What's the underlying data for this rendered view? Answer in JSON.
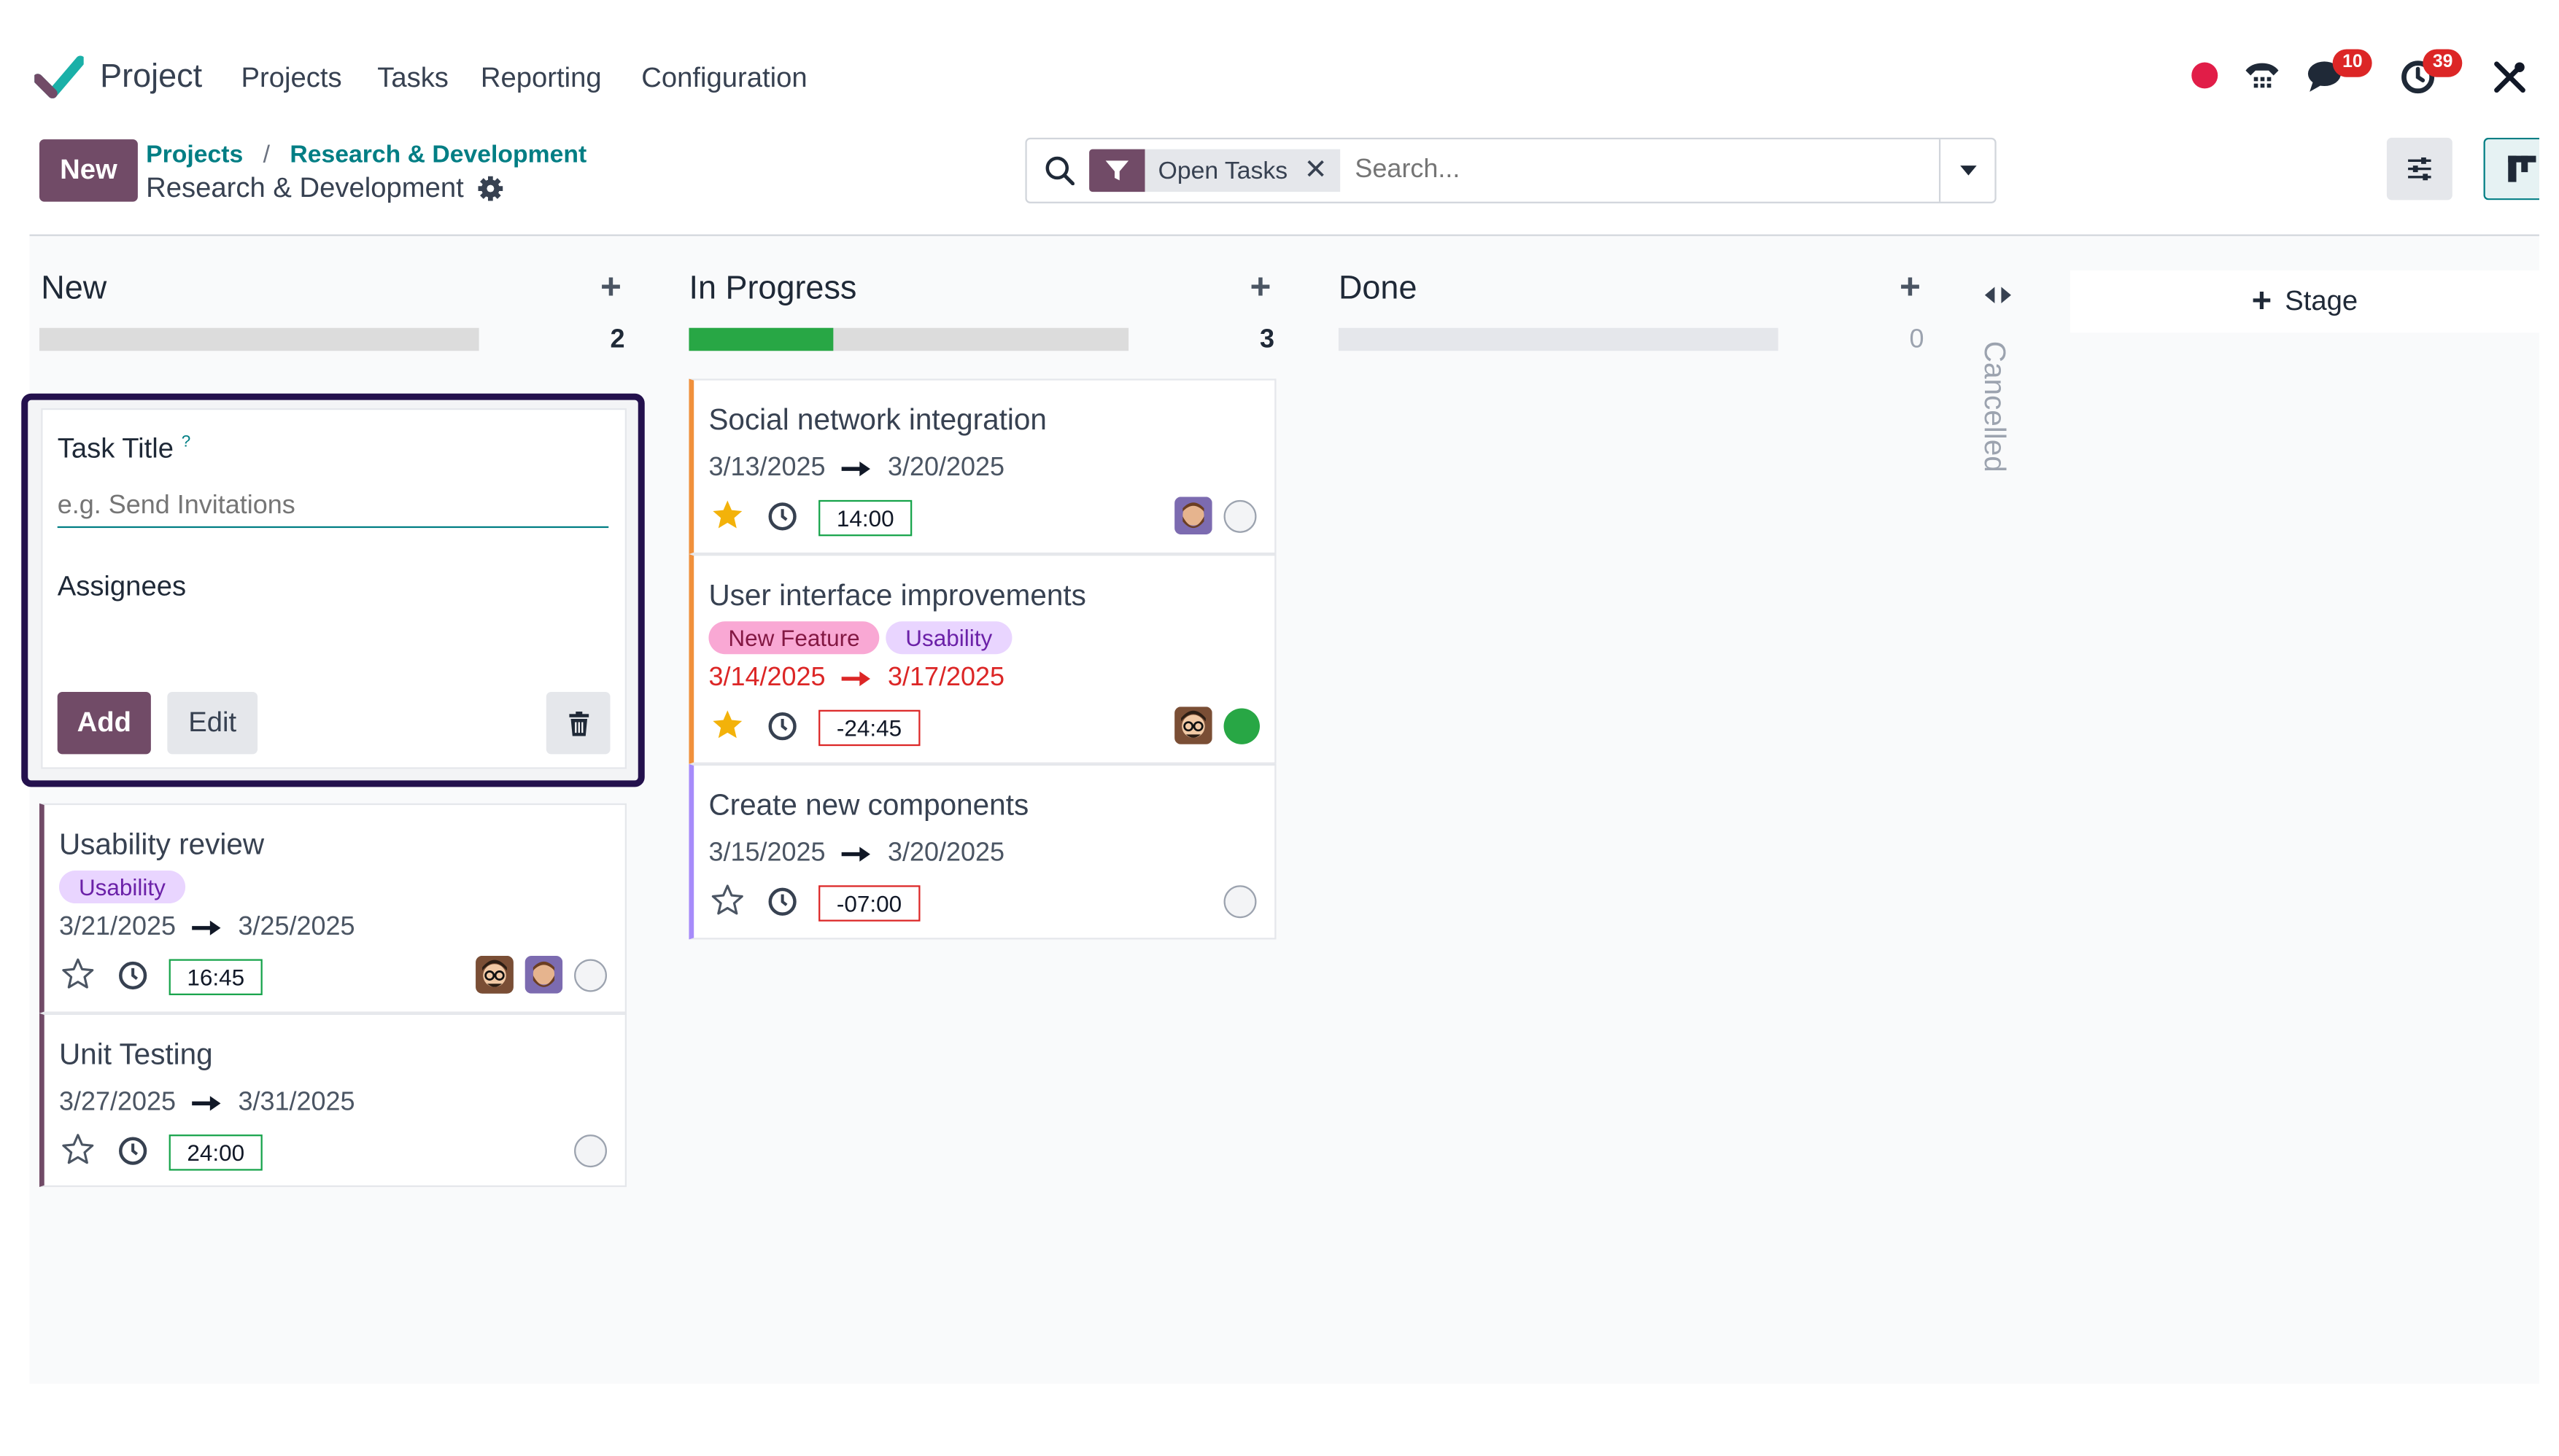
{
  "nav": {
    "app_name": "Project",
    "items": [
      "Projects",
      "Tasks",
      "Reporting",
      "Configuration"
    ],
    "messages_count": "10",
    "activities_count": "39"
  },
  "control": {
    "new_label": "New",
    "breadcrumb_root": "Projects",
    "breadcrumb_sep": "/",
    "breadcrumb_parent": "Research & Development",
    "current_title": "Research & Development",
    "filter_label": "Open Tasks",
    "search_placeholder": "Search..."
  },
  "columns": [
    {
      "title": "New",
      "count": "2",
      "progress": 0
    },
    {
      "title": "In Progress",
      "count": "3",
      "progress": 0.33
    },
    {
      "title": "Done",
      "count": "0",
      "progress": 0
    }
  ],
  "folded_column": "Cancelled",
  "add_stage_label": "Stage",
  "quick_create": {
    "title_label": "Task Title",
    "help_mark": "?",
    "title_placeholder": "e.g. Send Invitations",
    "assignees_label": "Assignees",
    "add_label": "Add",
    "edit_label": "Edit"
  },
  "cards": {
    "usability_review": {
      "title": "Usability review",
      "tag": "Usability",
      "start": "3/21/2025",
      "end": "3/25/2025",
      "time": "16:45"
    },
    "unit_testing": {
      "title": "Unit Testing",
      "start": "3/27/2025",
      "end": "3/31/2025",
      "time": "24:00"
    },
    "social_network": {
      "title": "Social network integration",
      "start": "3/13/2025",
      "end": "3/20/2025",
      "time": "14:00"
    },
    "ui_improvements": {
      "title": "User interface improvements",
      "tag1": "New Feature",
      "tag2": "Usability",
      "start": "3/14/2025",
      "end": "3/17/2025",
      "time": "-24:45"
    },
    "new_components": {
      "title": "Create new components",
      "start": "3/15/2025",
      "end": "3/20/2025",
      "time": "-07:00"
    }
  },
  "colors": {
    "brand": "#714b67",
    "link": "#017e84",
    "success": "#16a34a",
    "danger": "#dc2626",
    "star": "#f3b20a",
    "tag_usability_bg": "#e9d5ff",
    "tag_feature_bg": "#f9a8d4",
    "focus_border": "#24114d"
  }
}
